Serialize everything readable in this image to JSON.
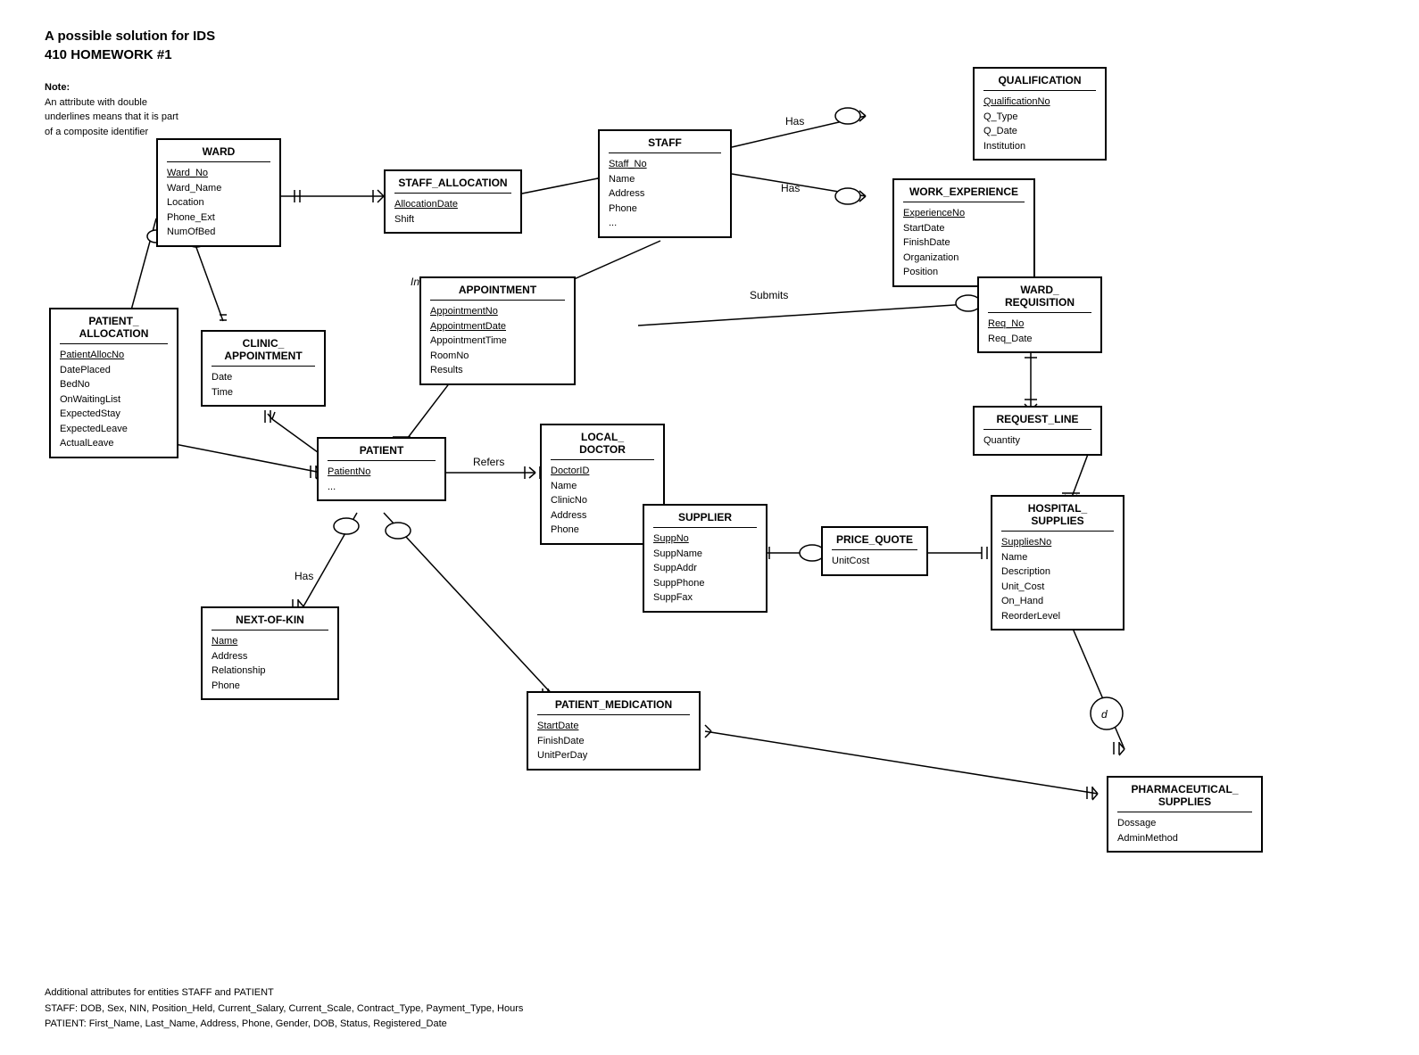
{
  "page": {
    "title_line1": "A possible solution for IDS",
    "title_line2": "410 HOMEWORK #1",
    "note_title": "Note:",
    "note_body": "An attribute with double\nunderlines  means that it is part\nof a composite identifier"
  },
  "entities": {
    "ward": {
      "title": "WARD",
      "attrs": [
        "Ward_No",
        "Ward_Name",
        "Location",
        "Phone_Ext",
        "NumOfBed"
      ]
    },
    "staff_allocation": {
      "title": "STAFF_ALLOCATION",
      "attrs": [
        "AllocationDate",
        "Shift"
      ]
    },
    "staff": {
      "title": "STAFF",
      "attrs": [
        "Staff_No",
        "Name",
        "Address",
        "Phone",
        "..."
      ]
    },
    "qualification": {
      "title": "QUALIFICATION",
      "attrs": [
        "QualificationNo",
        "Q_Type",
        "Q_Date",
        "Institution"
      ]
    },
    "work_experience": {
      "title": "WORK_EXPERIENCE",
      "attrs": [
        "ExperienceNo",
        "StartDate",
        "FinishDate",
        "Organization",
        "Position"
      ]
    },
    "patient_allocation": {
      "title": "PATIENT_\nALLOCATION",
      "attrs": [
        "PatientAllocNo",
        "DatePlaced",
        "BedNo",
        "OnWaitingList",
        "ExpectedStay",
        "ExpectedLeave",
        "ActualLeave"
      ]
    },
    "clinic_appointment": {
      "title": "CLINIC_\nAPPOINTMENT",
      "attrs": [
        "Date",
        "Time"
      ]
    },
    "appointment": {
      "title": "APPOINTMENT",
      "attrs": [
        "AppointmentNo",
        "AppointmentDate",
        "AppointmentTime",
        "RoomNo",
        "Results"
      ]
    },
    "ward_requisition": {
      "title": "WARD_\nREQUISITION",
      "attrs": [
        "Req_No",
        "Req_Date"
      ]
    },
    "request_line": {
      "title": "REQUEST_LINE",
      "attrs": [
        "Quantity"
      ]
    },
    "patient": {
      "title": "PATIENT",
      "attrs": [
        "PatientNo",
        "..."
      ]
    },
    "local_doctor": {
      "title": "LOCAL_\nDOCTOR",
      "attrs": [
        "DoctorID",
        "Name",
        "ClinicNo",
        "Address",
        "Phone"
      ]
    },
    "supplier": {
      "title": "SUPPLIER",
      "attrs": [
        "SuppNo",
        "SuppName",
        "SuppAddr",
        "SuppPhone",
        "SuppFax"
      ]
    },
    "price_quote": {
      "title": "PRICE_QUOTE",
      "attrs": [
        "UnitCost"
      ]
    },
    "hospital_supplies": {
      "title": "HOSPITAL_\nSUPPLIES",
      "attrs": [
        "SuppliesNo",
        "Name",
        "Description",
        "Unit_Cost",
        "On_Hand",
        "ReorderLevel"
      ]
    },
    "next_of_kin": {
      "title": "NEXT-OF-KIN",
      "attrs": [
        "Name",
        "Address",
        "Relationship",
        "Phone"
      ]
    },
    "patient_medication": {
      "title": "PATIENT_MEDICATION",
      "attrs": [
        "StartDate",
        "FinishDate",
        "UnitPerDay"
      ]
    },
    "pharmaceutical_supplies": {
      "title": "PHARMACEUTICAL_\nSUPPLIES",
      "attrs": [
        "Dossage",
        "AdminMethod"
      ]
    }
  },
  "relationships": {
    "has_qualification": "Has",
    "has_work_exp": "Has",
    "in_charge_of": "In Charge of",
    "submits": "Submits",
    "refers": "Refers",
    "has_next_of_kin": "Has"
  },
  "footer": {
    "line1": "Additional attributes for entities STAFF and PATIENT",
    "line2": "STAFF: DOB, Sex, NIN, Position_Held, Current_Salary, Current_Scale, Contract_Type, Payment_Type, Hours",
    "line3": "PATIENT: First_Name, Last_Name, Address, Phone, Gender, DOB, Status, Registered_Date"
  }
}
